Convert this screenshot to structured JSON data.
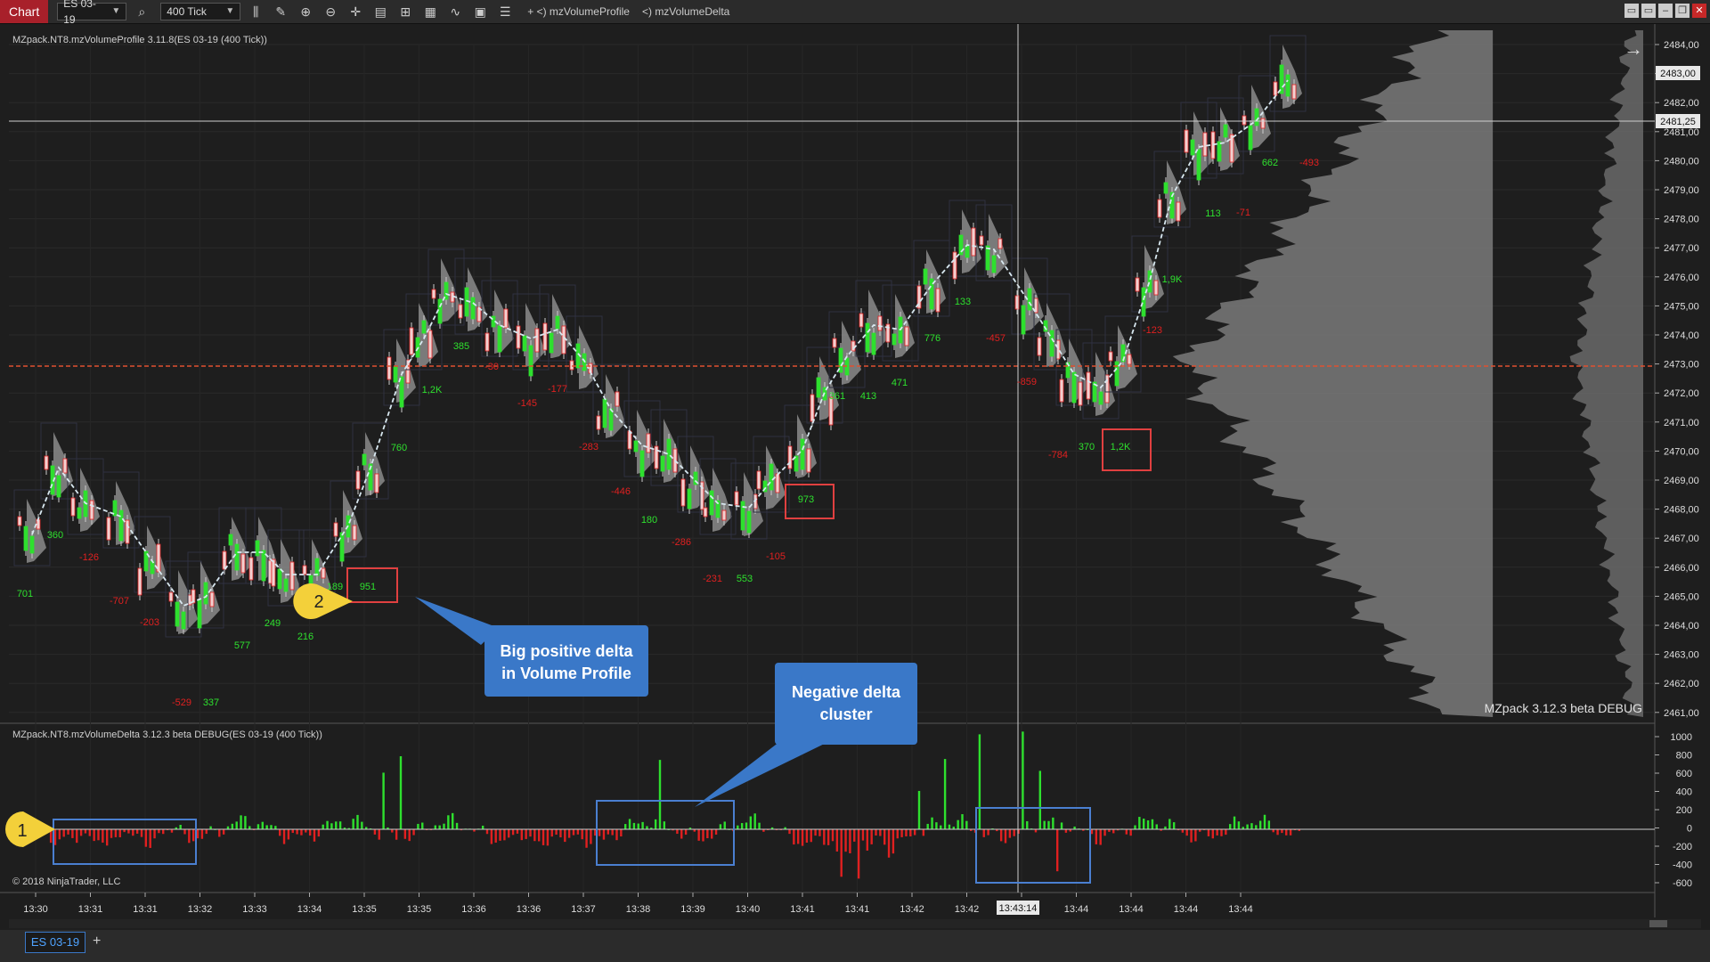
{
  "toolbar": {
    "chart_tab": "Chart",
    "instrument": "ES 03-19",
    "interval": "400 Tick",
    "indicators": [
      "mzVolumeProfile",
      "mzVolumeDelta"
    ],
    "icons": [
      "search-icon",
      "bar-style-icon",
      "draw-icon",
      "zoom-in-icon",
      "zoom-out-icon",
      "crosshair-icon",
      "data-box-icon",
      "templates-icon",
      "indicators-icon",
      "strategies-icon",
      "properties-icon",
      "list-icon"
    ]
  },
  "price_panel": {
    "title": "MZpack.NT8.mzVolumeProfile 3.11.8(ES 03-19 (400 Tick))",
    "watermark": "MZpack 3.12.3 beta DEBUG",
    "price_ticks": [
      "2484,00",
      "2483,00",
      "2482,00",
      "2481,00",
      "2480,00",
      "2479,00",
      "2478,00",
      "2477,00",
      "2476,00",
      "2475,00",
      "2474,00",
      "2473,00",
      "2472,00",
      "2471,00",
      "2470,00",
      "2469,00",
      "2468,00",
      "2467,00",
      "2466,00",
      "2465,00",
      "2464,00",
      "2463,00",
      "2462,00",
      "2461,00"
    ],
    "last_price_label": "2483,00",
    "cursor_price_label": "2481,25",
    "delta_labels": [
      {
        "text": "701",
        "color": "#2ee02e"
      },
      {
        "text": "360",
        "color": "#2ee02e"
      },
      {
        "text": "-126",
        "color": "#e02020"
      },
      {
        "text": "-707",
        "color": "#e02020"
      },
      {
        "text": "-203",
        "color": "#e02020"
      },
      {
        "text": "-529",
        "color": "#e02020"
      },
      {
        "text": "337",
        "color": "#2ee02e"
      },
      {
        "text": "577",
        "color": "#2ee02e"
      },
      {
        "text": "249",
        "color": "#2ee02e"
      },
      {
        "text": "216",
        "color": "#2ee02e"
      },
      {
        "text": "189",
        "color": "#2ee02e"
      },
      {
        "text": "951",
        "color": "#2ee02e"
      },
      {
        "text": "760",
        "color": "#2ee02e"
      },
      {
        "text": "1,2K",
        "color": "#2ee02e"
      },
      {
        "text": "385",
        "color": "#2ee02e"
      },
      {
        "text": "-30",
        "color": "#e02020"
      },
      {
        "text": "-145",
        "color": "#e02020"
      },
      {
        "text": "-177",
        "color": "#e02020"
      },
      {
        "text": "-283",
        "color": "#e02020"
      },
      {
        "text": "-446",
        "color": "#e02020"
      },
      {
        "text": "180",
        "color": "#2ee02e"
      },
      {
        "text": "-286",
        "color": "#e02020"
      },
      {
        "text": "-231",
        "color": "#e02020"
      },
      {
        "text": "553",
        "color": "#2ee02e"
      },
      {
        "text": "-105",
        "color": "#e02020"
      },
      {
        "text": "973",
        "color": "#2ee02e"
      },
      {
        "text": "361",
        "color": "#2ee02e"
      },
      {
        "text": "413",
        "color": "#2ee02e"
      },
      {
        "text": "471",
        "color": "#2ee02e"
      },
      {
        "text": "776",
        "color": "#2ee02e"
      },
      {
        "text": "133",
        "color": "#2ee02e"
      },
      {
        "text": "-457",
        "color": "#e02020"
      },
      {
        "text": "-859",
        "color": "#e02020"
      },
      {
        "text": "-784",
        "color": "#e02020"
      },
      {
        "text": "370",
        "color": "#2ee02e"
      },
      {
        "text": "1,2K",
        "color": "#2ee02e"
      },
      {
        "text": "-123",
        "color": "#e02020"
      },
      {
        "text": "1,9K",
        "color": "#2ee02e"
      },
      {
        "text": "113",
        "color": "#2ee02e"
      },
      {
        "text": "-71",
        "color": "#e02020"
      },
      {
        "text": "662",
        "color": "#2ee02e"
      },
      {
        "text": "-493",
        "color": "#e02020"
      }
    ],
    "callout_positive": "Big positive delta in Volume Profile",
    "marker_2": "2"
  },
  "delta_panel": {
    "title": "MZpack.NT8.mzVolumeDelta 3.12.3 beta DEBUG(ES 03-19 (400 Tick))",
    "copyright": "© 2018 NinjaTrader, LLC",
    "delta_ticks": [
      "1000",
      "800",
      "600",
      "400",
      "200",
      "0",
      "-200",
      "-400",
      "-600"
    ],
    "callout_negative": "Negative delta cluster",
    "marker_1": "1"
  },
  "time_axis": {
    "labels": [
      "13:30",
      "13:31",
      "13:31",
      "13:32",
      "13:33",
      "13:34",
      "13:35",
      "13:35",
      "13:36",
      "13:36",
      "13:37",
      "13:38",
      "13:39",
      "13:40",
      "13:41",
      "13:41",
      "13:42",
      "13:42",
      "13:43",
      "13:44",
      "13:44",
      "13:44",
      "13:44"
    ],
    "cursor_time": "13:43:14"
  },
  "bottom_tabs": {
    "active": "ES 03-19",
    "add": "+"
  },
  "colors": {
    "background": "#1e1e1e",
    "up_candle": "#2ee02e",
    "down_candle": "#e02020",
    "volume_profile": "#8a8a8a",
    "callout": "#3a78c8",
    "highlight_box_red": "#e04040",
    "highlight_box_blue": "#4a7fd0",
    "marker_yellow": "#f3d03a",
    "poc_line": "#e05030"
  }
}
